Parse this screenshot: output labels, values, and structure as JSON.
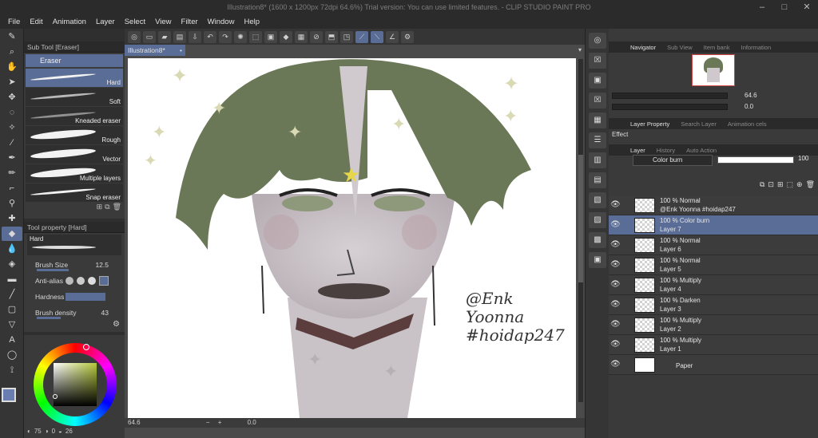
{
  "window": {
    "title": "Illustration8* (1600 x 1200px 72dpi 64.6%)  Trial version: You can use limited features. - CLIP STUDIO PAINT PRO",
    "minimize": "–",
    "maximize": "□",
    "close": "✕"
  },
  "menu": [
    "File",
    "Edit",
    "Animation",
    "Layer",
    "Select",
    "View",
    "Filter",
    "Window",
    "Help"
  ],
  "subtool": {
    "header": "Sub Tool [Eraser]",
    "group": "Eraser",
    "brushes": [
      "Hard",
      "Soft",
      "Kneaded eraser",
      "Rough",
      "Vector",
      "Multiple layers",
      "Snap eraser"
    ]
  },
  "toolprop": {
    "header": "Tool property [Hard]",
    "preset": "Hard",
    "brush_size_label": "Brush Size",
    "brush_size_value": "12.5",
    "antialias_label": "Anti-alias",
    "hardness_label": "Hardness",
    "density_label": "Brush density",
    "density_value": "43"
  },
  "color": {
    "main": "#6a7db0",
    "sub": "#ffffff",
    "value1": "75",
    "value2": "0",
    "value3": "26"
  },
  "document": {
    "tab": "Illustration8*",
    "zoom": "64.6",
    "rotation": "0.0"
  },
  "artwork": {
    "signature_line1": "@Enk",
    "signature_line2": "Yoonna",
    "signature_line3": "#hoidap247"
  },
  "navigator": {
    "tabs": [
      "Navigator",
      "Sub View",
      "Item bank",
      "Information"
    ],
    "zoom": "64.6",
    "rotation": "0.0"
  },
  "property_tabs": [
    "Layer Property",
    "Search Layer",
    "Animation cels"
  ],
  "effect_label": "Effect",
  "layer_tabs": [
    "Layer",
    "History",
    "Auto Action"
  ],
  "layer_panel": {
    "blend_mode": "Color burn",
    "opacity": "100"
  },
  "layers": [
    {
      "line1": "100 % Normal",
      "line2": "@Enk Yoonna #hoidap247",
      "selected": false
    },
    {
      "line1": "100 % Color burn",
      "line2": "Layer 7",
      "selected": true
    },
    {
      "line1": "100 % Normal",
      "line2": "Layer 6",
      "selected": false
    },
    {
      "line1": "100 % Normal",
      "line2": "Layer 5",
      "selected": false
    },
    {
      "line1": "100 % Multiply",
      "line2": "Layer 4",
      "selected": false
    },
    {
      "line1": "100 % Darken",
      "line2": "Layer 3",
      "selected": false
    },
    {
      "line1": "100 % Multiply",
      "line2": "Layer 2",
      "selected": false
    },
    {
      "line1": "100 % Multiply",
      "line2": "Layer 1",
      "selected": false
    },
    {
      "line1": "",
      "line2": "Paper",
      "selected": false
    }
  ]
}
